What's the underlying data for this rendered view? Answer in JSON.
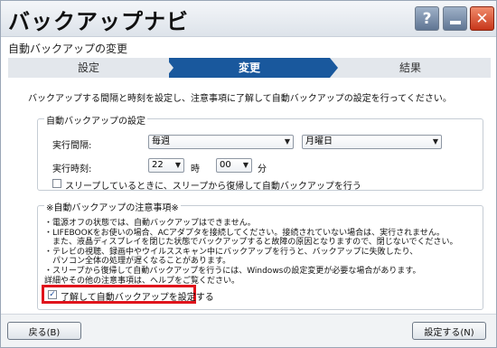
{
  "window": {
    "title": "バックアップナビ",
    "help_glyph": "?",
    "close_glyph": "✕"
  },
  "page": {
    "subtitle": "自動バックアップの変更",
    "steps": [
      {
        "label": "設定",
        "active": false
      },
      {
        "label": "変更",
        "active": true
      },
      {
        "label": "結果",
        "active": false
      }
    ],
    "intro": "バックアップする間隔と時刻を設定し、注意事項に了解して自動バックアップの設定を行ってください。"
  },
  "settings": {
    "group_title": "自動バックアップの設定",
    "interval_label": "実行間隔:",
    "interval_value": "毎週",
    "day_value": "月曜日",
    "time_label": "実行時刻:",
    "hour_value": "22",
    "hour_unit": "時",
    "minute_value": "00",
    "minute_unit": "分",
    "sleep_checkbox_label": "スリープしているときに、スリープから復帰して自動バックアップを行う",
    "sleep_checked": false
  },
  "notes": {
    "group_title": "※自動バックアップの注意事項※",
    "lines": [
      "・電源オフの状態では、自動バックアップはできません。",
      "・LIFEBOOKをお使いの場合、ACアダプタを接続してください。接続されていない場合は、実行されません。",
      "　また、液晶ディスプレイを閉じた状態でバックアップすると故障の原因となりますので、閉じないでください。",
      "・テレビの視聴、録画中やウイルススキャン中にバックアップを行うと、バックアップに失敗したり、",
      "　パソコン全体の処理が遅くなることがあります。",
      "・スリープから復帰して自動バックアップを行うには、Windowsの設定変更が必要な場合があります。",
      "詳細やその他の注意事項は、ヘルプをご覧ください。"
    ],
    "agree_label": "了解して自動バックアップを設定する",
    "agree_checked": true,
    "highlight_color": "#e0141c"
  },
  "footer": {
    "back_label": "戻る(B)",
    "set_label": "設定する(N)"
  },
  "colors": {
    "active_step": "#19589d",
    "inactive_step": "#e3e7ec"
  }
}
